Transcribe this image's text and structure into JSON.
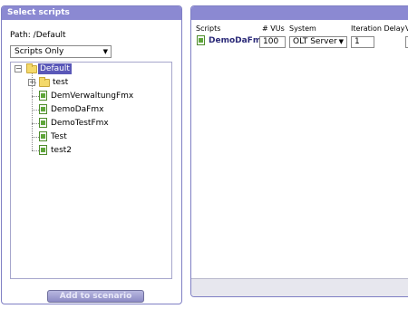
{
  "left_panel": {
    "title": "Select scripts",
    "path_label": "Path: /Default",
    "filter": {
      "selected": "Scripts Only"
    },
    "tree": {
      "root": "Default",
      "folder": "test",
      "scripts": [
        "DemVerwaltungFmx",
        "DemoDaFmx",
        "DemoTestFmx",
        "Test",
        "test2"
      ]
    },
    "add_button": "Add to scenario"
  },
  "right_panel": {
    "columns": [
      "Scripts",
      "# VUs",
      "System",
      "Iteration Delay",
      "V"
    ],
    "rows": [
      {
        "script": "DemoDaFmx",
        "vus": "100",
        "system": "OLT Server",
        "iteration_delay": "1"
      }
    ]
  },
  "colors": {
    "title_bar": "#8b89d2",
    "selection": "#5a58b8",
    "script_name": "#2b2a78"
  }
}
